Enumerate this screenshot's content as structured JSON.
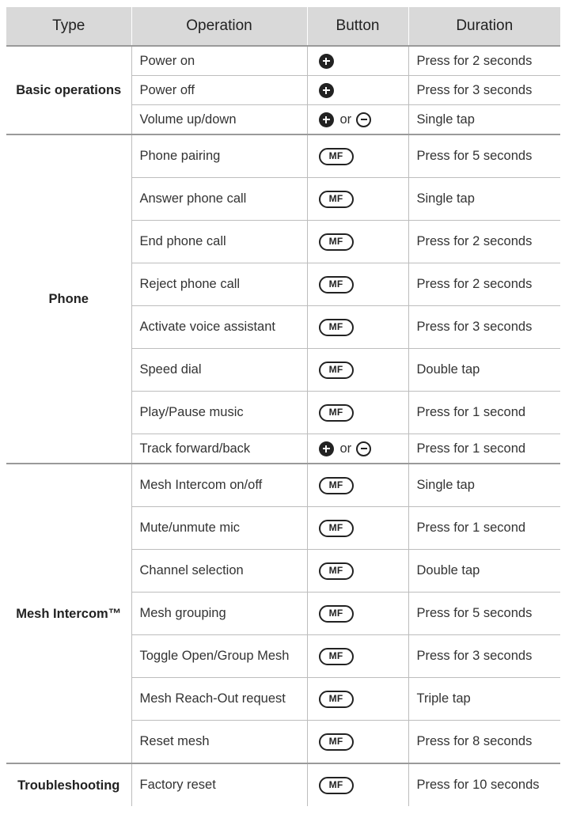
{
  "headers": {
    "type": "Type",
    "operation": "Operation",
    "button": "Button",
    "duration": "Duration"
  },
  "connector": "or",
  "mf_label": "MF",
  "groups": [
    {
      "type": "Basic operations",
      "rows": [
        {
          "operation": "Power on",
          "button": "plus-icon",
          "duration": "Press for 2 seconds"
        },
        {
          "operation": "Power off",
          "button": "plus-icon",
          "duration": "Press for 3 seconds"
        },
        {
          "operation": "Volume up/down",
          "button": "plus-or-minus",
          "duration": "Single tap"
        }
      ]
    },
    {
      "type": "Phone",
      "rows": [
        {
          "operation": "Phone pairing",
          "button": "mf-icon",
          "duration": "Press for 5 seconds"
        },
        {
          "operation": "Answer phone call",
          "button": "mf-icon",
          "duration": "Single tap"
        },
        {
          "operation": "End phone call",
          "button": "mf-icon",
          "duration": "Press for 2 seconds"
        },
        {
          "operation": "Reject phone call",
          "button": "mf-icon",
          "duration": "Press for 2 seconds"
        },
        {
          "operation": "Activate voice assistant",
          "button": "mf-icon",
          "duration": "Press for 3 seconds"
        },
        {
          "operation": "Speed dial",
          "button": "mf-icon",
          "duration": "Double tap"
        },
        {
          "operation": "Play/Pause music",
          "button": "mf-icon",
          "duration": "Press for 1 second"
        },
        {
          "operation": "Track forward/back",
          "button": "plus-or-minus",
          "duration": "Press for 1 second"
        }
      ]
    },
    {
      "type": "Mesh Intercom™",
      "rows": [
        {
          "operation": "Mesh Intercom on/off",
          "button": "mf-icon",
          "duration": "Single tap"
        },
        {
          "operation": "Mute/unmute mic",
          "button": "mf-icon",
          "duration": "Press for 1 second"
        },
        {
          "operation": "Channel selection",
          "button": "mf-icon",
          "duration": "Double tap"
        },
        {
          "operation": "Mesh grouping",
          "button": "mf-icon",
          "duration": "Press for 5 seconds"
        },
        {
          "operation": "Toggle Open/Group Mesh",
          "button": "mf-icon",
          "duration": "Press for 3 seconds"
        },
        {
          "operation": "Mesh Reach-Out request",
          "button": "mf-icon",
          "duration": "Triple tap"
        },
        {
          "operation": "Reset mesh",
          "button": "mf-icon",
          "duration": "Press for 8 seconds"
        }
      ]
    },
    {
      "type": "Troubleshooting",
      "rows": [
        {
          "operation": "Factory reset",
          "button": "mf-icon",
          "duration": "Press for 10 seconds"
        }
      ]
    }
  ]
}
